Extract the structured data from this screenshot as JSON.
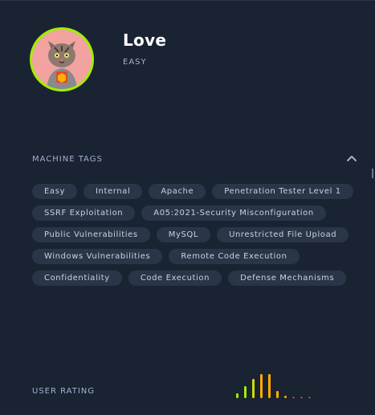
{
  "machine": {
    "name": "Love",
    "difficulty": "EASY"
  },
  "machine_tags": {
    "label": "MACHINE TAGS",
    "tags": [
      "Easy",
      "Internal",
      "Apache",
      "Penetration Tester Level 1",
      "SSRF Exploitation",
      "A05:2021-Security Misconfiguration",
      "Public Vulnerabilities",
      "MySQL",
      "Unrestricted File Upload",
      "Windows Vulnerabilities",
      "Remote Code Execution",
      "Confidentiality",
      "Code Execution",
      "Defense Mechanisms"
    ]
  },
  "user_rating": {
    "label": "USER RATING",
    "bars": [
      {
        "level": 0.2,
        "color": "#9fef00"
      },
      {
        "level": 0.5,
        "color": "#9fef00"
      },
      {
        "level": 0.8,
        "color": "#c7e000"
      },
      {
        "level": 1.0,
        "color": "#ffaf00"
      },
      {
        "level": 1.0,
        "color": "#ffaf00"
      },
      {
        "level": 0.3,
        "color": "#ffaf00"
      },
      {
        "level": 0.1,
        "color": "#ffaf00"
      },
      {
        "level": 0.03,
        "color": "#ff3e3e"
      },
      {
        "level": 0.03,
        "color": "#ff3e3e"
      },
      {
        "level": 0.03,
        "color": "#ff3e3e"
      }
    ]
  },
  "colors": {
    "background": "#1a2332",
    "tag_background": "#2a3547",
    "accent": "#9fef00"
  }
}
